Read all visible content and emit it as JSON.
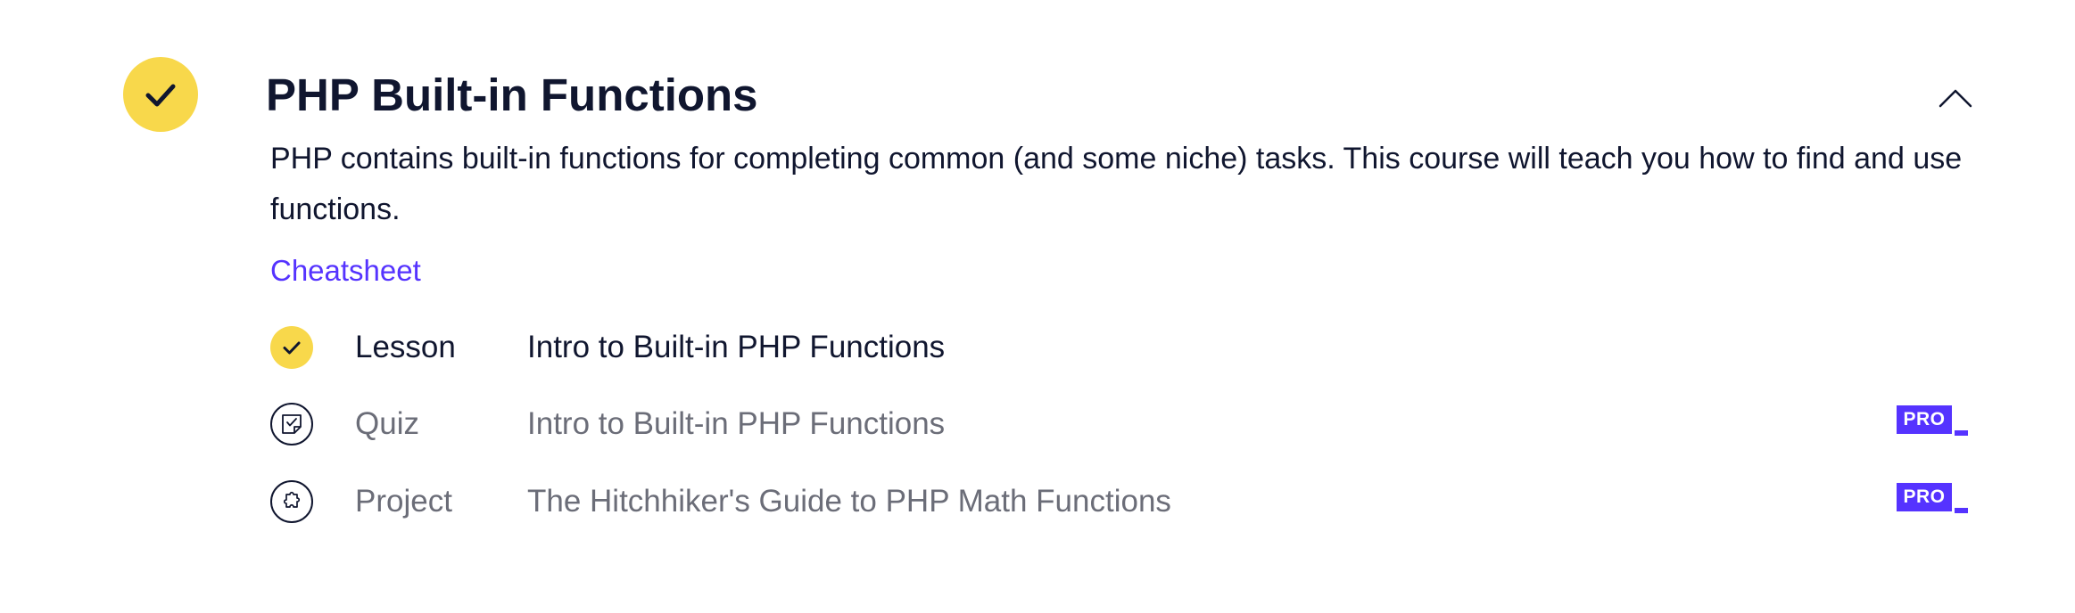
{
  "module": {
    "title": "PHP Built-in Functions",
    "completed": true,
    "expanded": true,
    "status_icon": "check-icon",
    "toggle_icon": "chevron-up-icon",
    "description": "PHP contains built-in functions for completing common (and some niche) tasks. This course will teach you how to find and use functions.",
    "cheatsheet_label": "Cheatsheet"
  },
  "items": [
    {
      "type": "Lesson",
      "name": "Intro to Built-in PHP Functions",
      "icon": "check-icon",
      "completed": true,
      "pro": false
    },
    {
      "type": "Quiz",
      "name": "Intro to Built-in PHP Functions",
      "icon": "quiz-icon",
      "completed": false,
      "pro": true,
      "pro_label": "PRO"
    },
    {
      "type": "Project",
      "name": "The Hitchhiker's Guide to PHP Math Functions",
      "icon": "puzzle-icon",
      "completed": false,
      "pro": true,
      "pro_label": "PRO"
    }
  ],
  "colors": {
    "accent_yellow": "#f8d84b",
    "link_purple": "#5533ff",
    "text_dark": "#10162f",
    "text_muted": "#6b6d78"
  }
}
